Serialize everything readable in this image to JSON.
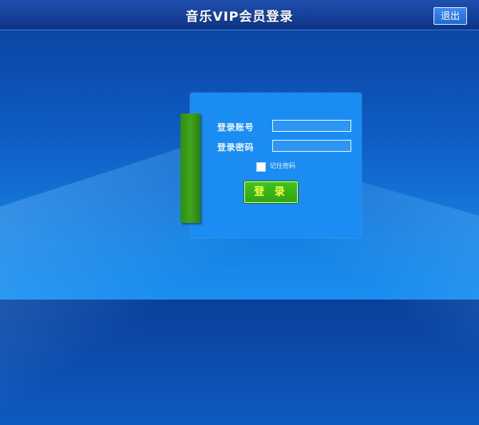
{
  "header": {
    "title": "音乐VIP会员登录",
    "logout_label": "退出"
  },
  "login_form": {
    "account_label": "登录账号",
    "password_label": "登录密码",
    "account_value": "",
    "password_value": "",
    "remember_label": "记住密码",
    "remember_checked": false,
    "submit_label": "登 录"
  },
  "colors": {
    "header_bg": "#153f97",
    "panel_bg": "#1b8df2",
    "accent_green": "#3fa51c",
    "button_text": "#f4ff48"
  }
}
